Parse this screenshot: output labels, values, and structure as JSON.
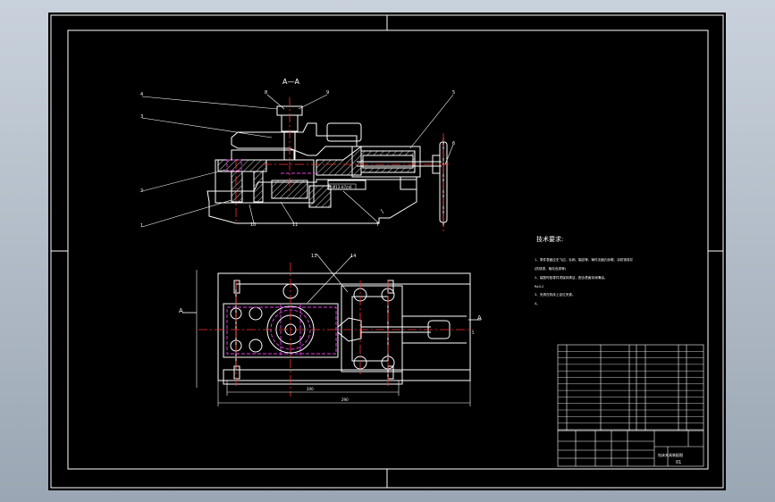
{
  "drawing": {
    "section_title": "A—A",
    "notes_title": "技术要求:",
    "notes": [
      "1、零件表面应无飞边、毛刺、裂纹等，铸件无缩孔砂眼，涂防锈漆并",
      "(防锈漆、暗灰色漆等)",
      "2、装配时各零件须保持清洁，配合表面涂润滑油。",
      "Ra3.2",
      "3、夹具在机床上定位夹紧。",
      "4。"
    ],
    "part_balloons": [
      "1",
      "2",
      "3",
      "4",
      "5",
      "6",
      "7",
      "8",
      "9",
      "10",
      "11",
      "12",
      "13",
      "14"
    ],
    "section_markers": [
      "A",
      "A"
    ],
    "dimension_text": [
      "200",
      "290",
      "5"
    ],
    "title_block": {
      "drawing_name": "钻床夹具装配图",
      "drawing_number": "01"
    }
  },
  "colors": {
    "background": "#000000",
    "outline": "#ffffff",
    "center_line": "#ff3030",
    "hidden_line": "#e040e0",
    "leader": "#ffffff",
    "hatch": "#ffffff",
    "dimension": "#00d8d8",
    "text": "#ffffff",
    "title_text": "#ffff55"
  }
}
